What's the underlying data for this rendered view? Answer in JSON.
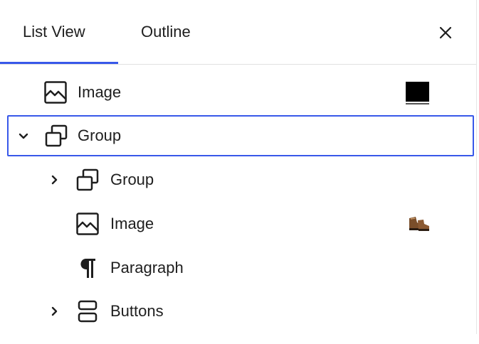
{
  "tabs": {
    "list_view": "List View",
    "outline": "Outline",
    "active": "List View",
    "accent_color": "#3858e9"
  },
  "close": {
    "icon": "close-icon"
  },
  "rows": [
    {
      "label": "Image",
      "icon": "image-icon",
      "expander": "none",
      "thumbnail": "dark-square-thumbnail",
      "selected": false,
      "level": 1
    },
    {
      "label": "Group",
      "icon": "group-icon",
      "expander": "expanded",
      "thumbnail": "",
      "selected": true,
      "level": 1
    },
    {
      "label": "Group",
      "icon": "group-icon",
      "expander": "collapsed",
      "thumbnail": "",
      "selected": false,
      "level": 2
    },
    {
      "label": "Image",
      "icon": "image-icon",
      "expander": "none",
      "thumbnail": "boot-thumbnail",
      "selected": false,
      "level": 2
    },
    {
      "label": "Paragraph",
      "icon": "paragraph-icon",
      "expander": "none",
      "thumbnail": "",
      "selected": false,
      "level": 2
    },
    {
      "label": "Buttons",
      "icon": "buttons-icon",
      "expander": "collapsed",
      "thumbnail": "",
      "selected": false,
      "level": 2
    }
  ]
}
